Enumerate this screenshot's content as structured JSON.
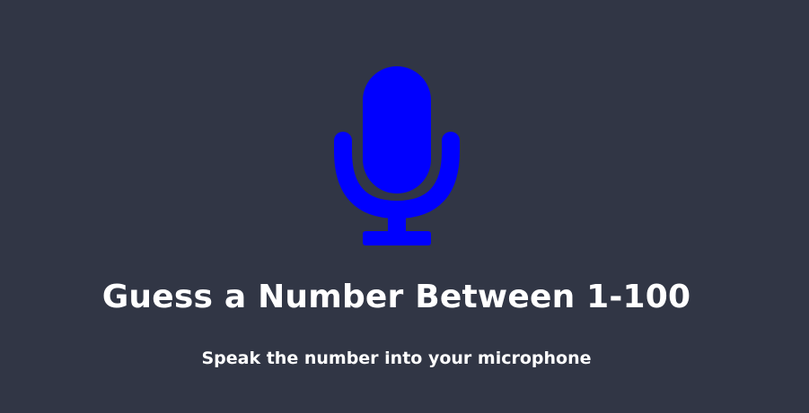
{
  "icon": {
    "name": "microphone-icon",
    "color": "#0000ff"
  },
  "colors": {
    "background": "#313645",
    "text": "#ffffff"
  },
  "heading": {
    "title": "Guess a Number Between 1-100",
    "subtitle": "Speak the number into your microphone"
  }
}
